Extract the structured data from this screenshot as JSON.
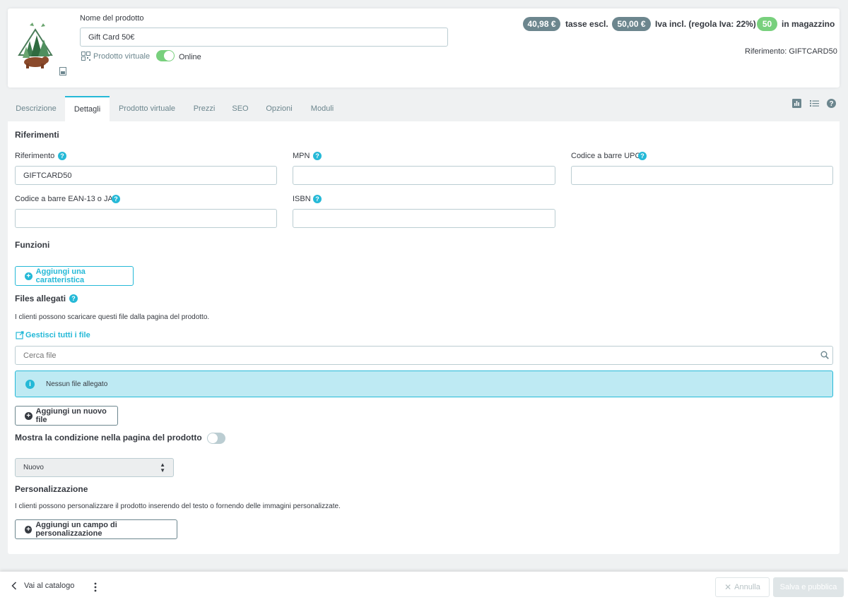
{
  "header": {
    "name_label": "Nome del prodotto",
    "name_value": "Gift Card 50€",
    "virtual_label": "Prodotto virtuale",
    "online_label": "Online",
    "online_enabled": true,
    "price_excl": "40,98 €",
    "price_excl_label": "tasse escl.",
    "price_incl": "50,00 €",
    "price_incl_label": "Iva incl. (regola Iva: 22%)",
    "stock": "50",
    "stock_label": "in magazzino",
    "reference_text": "Riferimento: GIFTCARD50"
  },
  "tabs": [
    {
      "label": "Descrizione",
      "active": false
    },
    {
      "label": "Dettagli",
      "active": true
    },
    {
      "label": "Prodotto virtuale",
      "active": false
    },
    {
      "label": "Prezzi",
      "active": false
    },
    {
      "label": "SEO",
      "active": false
    },
    {
      "label": "Opzioni",
      "active": false
    },
    {
      "label": "Moduli",
      "active": false
    }
  ],
  "toolbar_icons": [
    "bar-chart-icon",
    "list-icon",
    "help-icon"
  ],
  "references": {
    "title": "Riferimenti",
    "reference_label": "Riferimento",
    "reference_value": "GIFTCARD50",
    "mpn_label": "MPN",
    "mpn_value": "",
    "upc_label": "Codice a barre UPC",
    "upc_value": "",
    "ean_label": "Codice a barre EAN-13 o JAN",
    "ean_value": "",
    "isbn_label": "ISBN",
    "isbn_value": ""
  },
  "features": {
    "title": "Funzioni",
    "add_button": "Aggiungi una caratteristica"
  },
  "attachments": {
    "title": "Files allegati",
    "description": "I clienti possono scaricare questi file dalla pagina del prodotto.",
    "manage_link": "Gestisci tutti i file",
    "search_placeholder": "Cerca file",
    "empty_message": "Nessun file allegato",
    "add_button": "Aggiungi un nuovo file"
  },
  "condition": {
    "title": "Mostra la condizione nella pagina del prodotto",
    "enabled": false,
    "selected": "Nuovo"
  },
  "customization": {
    "title": "Personalizzazione",
    "description": "I clienti possono personalizzare il prodotto inserendo del testo o fornendo delle immagini personalizzate.",
    "add_button": "Aggiungi un campo di personalizzazione"
  },
  "footer": {
    "back_label": "Vai al catalogo",
    "cancel_label": "Annulla",
    "save_label": "Salva e pubblica"
  },
  "colors": {
    "accent": "#25b9d7",
    "success": "#78d07d",
    "pill_gray": "#6c868e"
  }
}
